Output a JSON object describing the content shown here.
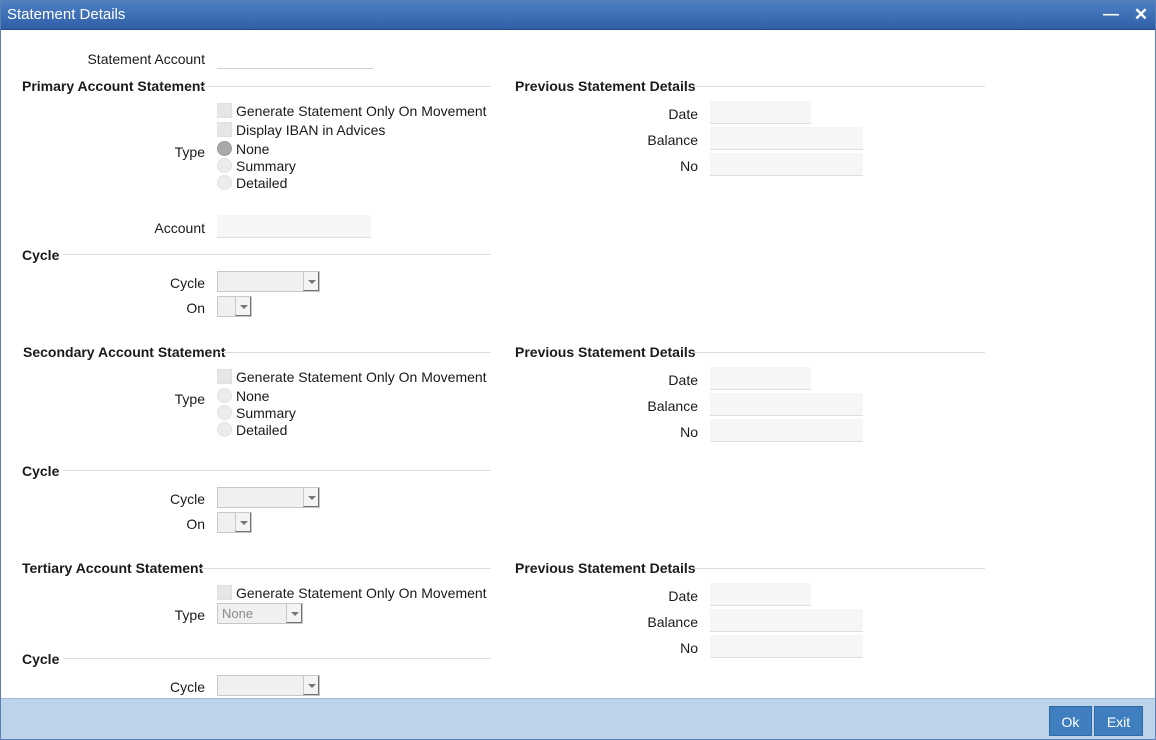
{
  "window": {
    "title": "Statement Details"
  },
  "statement_account": {
    "label": "Statement Account",
    "value": ""
  },
  "primary": {
    "section_title": "Primary Account Statement",
    "gen_on_movement": "Generate Statement Only On Movement",
    "display_iban": "Display IBAN in Advices",
    "type_label": "Type",
    "type_options": [
      "None",
      "Summary",
      "Detailed"
    ],
    "type_selected": "None",
    "account_label": "Account",
    "account_value": "",
    "cycle_section": "Cycle",
    "cycle_label": "Cycle",
    "cycle_value": "",
    "on_label": "On",
    "on_value": ""
  },
  "primary_prev": {
    "section_title": "Previous Statement Details",
    "date_label": "Date",
    "date_value": "",
    "balance_label": "Balance",
    "balance_value": "",
    "no_label": "No",
    "no_value": ""
  },
  "secondary": {
    "section_title": "Secondary Account Statement",
    "gen_on_movement": "Generate Statement Only On Movement",
    "type_label": "Type",
    "type_options": [
      "None",
      "Summary",
      "Detailed"
    ],
    "cycle_section": "Cycle",
    "cycle_label": "Cycle",
    "cycle_value": "",
    "on_label": "On",
    "on_value": ""
  },
  "secondary_prev": {
    "section_title": "Previous Statement Details",
    "date_label": "Date",
    "date_value": "",
    "balance_label": "Balance",
    "balance_value": "",
    "no_label": "No",
    "no_value": ""
  },
  "tertiary": {
    "section_title": "Tertiary Account Statement",
    "gen_on_movement": "Generate Statement Only On Movement",
    "type_label": "Type",
    "type_value": "None",
    "cycle_section": "Cycle",
    "cycle_label": "Cycle",
    "cycle_value": ""
  },
  "tertiary_prev": {
    "section_title": "Previous Statement Details",
    "date_label": "Date",
    "date_value": "",
    "balance_label": "Balance",
    "balance_value": "",
    "no_label": "No",
    "no_value": ""
  },
  "footer": {
    "ok_label": "Ok",
    "exit_label": "Exit"
  },
  "colors": {
    "titlebar": "#3f6fb5",
    "footer": "#bcd3ea",
    "button": "#3f7fbf"
  }
}
